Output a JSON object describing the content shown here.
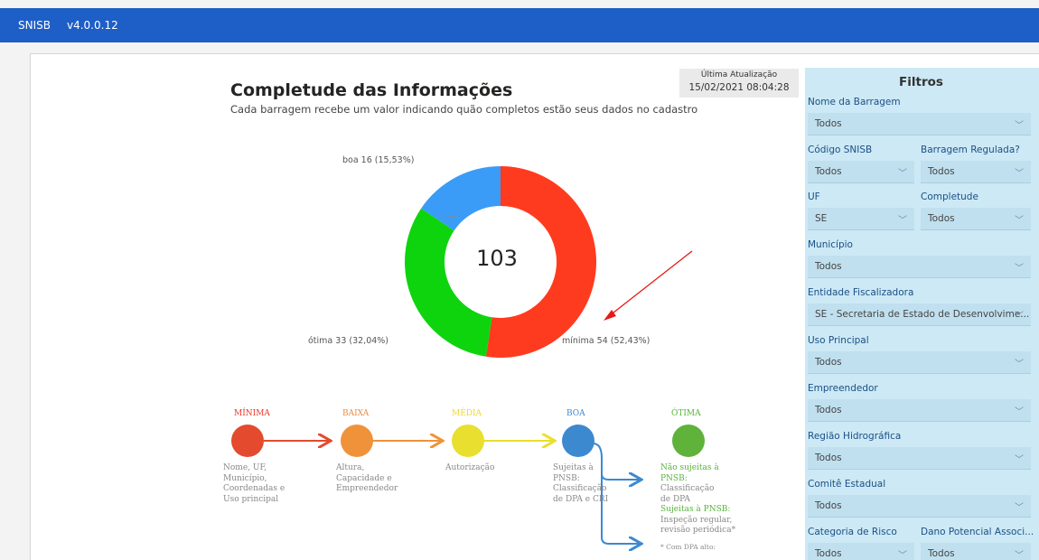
{
  "header": {
    "app_name": "SNISB",
    "version": "v4.0.0.12"
  },
  "report": {
    "title": "Completude das Informações",
    "subtitle": "Cada barragem recebe um valor indicando quão completos estão seus dados no cadastro",
    "last_update_label": "Última Atualização",
    "last_update_value": "15/02/2021 08:04:28"
  },
  "chart_data": {
    "type": "pie",
    "center_total": "103",
    "slices": [
      {
        "label": "mínima 54 (52,43%)",
        "name": "mínima",
        "value": 54,
        "color": "#ff3b1f"
      },
      {
        "label": "ótima 33 (32,04%)",
        "name": "ótima",
        "value": 33,
        "color": "#0ed40e"
      },
      {
        "label": "boa 16 (15,53%)",
        "name": "boa",
        "value": 16,
        "color": "#3a9cf7"
      }
    ]
  },
  "flow": {
    "levels": [
      {
        "name": "MÍNIMA",
        "color": "#e8382a",
        "circle": "#e34a2e",
        "desc": [
          "Nome, UF,",
          "Município,",
          "Coordenadas e",
          "Uso principal"
        ]
      },
      {
        "name": "BAIXA",
        "color": "#f08a3c",
        "circle": "#f0923a",
        "desc": [
          "Altura,",
          "Capacidade e",
          "Empreendedor"
        ]
      },
      {
        "name": "MÉDIA",
        "color": "#e9d83a",
        "circle": "#e9df2e",
        "desc": [
          "Autorização"
        ]
      },
      {
        "name": "BOA",
        "color": "#3d89d0",
        "circle": "#3d89d0",
        "desc": [
          "Sujeitas à",
          "PNSB:",
          "Classificação",
          "de DPA e CRI"
        ]
      },
      {
        "name": "ÓTIMA",
        "color": "#58b33a",
        "circle": "#5fb23a"
      }
    ],
    "otima_desc": [
      {
        "text": "Não sujeitas à",
        "green": true
      },
      {
        "text": "PNSB:",
        "green": true
      },
      {
        "text": "Classificação",
        "green": false
      },
      {
        "text": "de DPA",
        "green": false
      },
      {
        "text": "Sujeitas à PNSB:",
        "green": true
      },
      {
        "text": "Inspeção regular,",
        "green": false
      },
      {
        "text": "revisão periódica*",
        "green": false
      }
    ],
    "footnote": "* Com DPA alto:"
  },
  "filters": {
    "title": "Filtros",
    "nome_barragem": {
      "label": "Nome da Barragem",
      "value": "Todos"
    },
    "codigo_snisb": {
      "label": "Código SNISB",
      "value": "Todos"
    },
    "barragem_regulada": {
      "label": "Barragem Regulada?",
      "value": "Todos"
    },
    "uf": {
      "label": "UF",
      "value": "SE"
    },
    "completude": {
      "label": "Completude",
      "value": "Todos"
    },
    "municipio": {
      "label": "Município",
      "value": "Todos"
    },
    "entidade": {
      "label": "Entidade Fiscalizadora",
      "value": "SE - Secretaria de Estado de Desenvolvime..."
    },
    "uso_principal": {
      "label": "Uso Principal",
      "value": "Todos"
    },
    "empreendedor": {
      "label": "Empreendedor",
      "value": "Todos"
    },
    "regiao": {
      "label": "Região Hidrográfica",
      "value": "Todos"
    },
    "comite": {
      "label": "Comitê Estadual",
      "value": "Todos"
    },
    "categoria_risco": {
      "label": "Categoria de Risco",
      "value": "Todos"
    },
    "dano_potencial": {
      "label": "Dano Potencial Associ...",
      "value": "Todos"
    }
  }
}
